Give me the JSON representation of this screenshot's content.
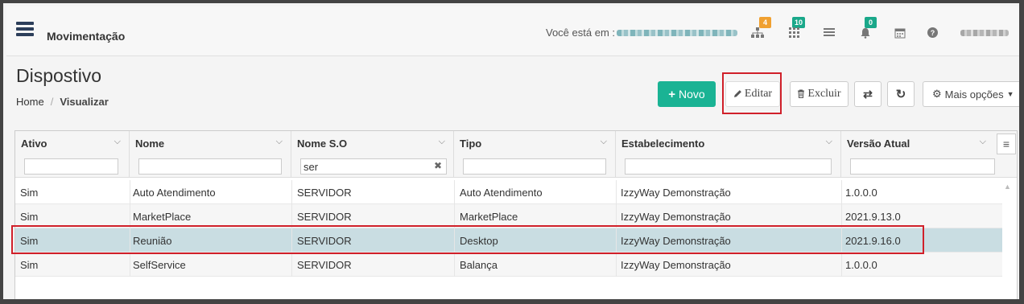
{
  "topbar": {
    "app_title": "Movimentação",
    "you_are_at": "Você está em :",
    "badge_tree": "4",
    "badge_grid": "10",
    "badge_bell": "0"
  },
  "page": {
    "title": "Dispostivo",
    "breadcrumb_home": "Home",
    "breadcrumb_sep": "/",
    "breadcrumb_current": "Visualizar"
  },
  "toolbar": {
    "novo": "Novo",
    "editar": "Editar",
    "excluir": "Excluir",
    "mais_opcoes": "Mais opções"
  },
  "grid": {
    "columns": [
      "Ativo",
      "Nome",
      "Nome S.O",
      "Tipo",
      "Estabelecimento",
      "Versão Atual"
    ],
    "filters": [
      "",
      "",
      "ser",
      "",
      "",
      ""
    ],
    "rows": [
      [
        "Sim",
        "Auto Atendimento",
        "SERVIDOR",
        "Auto Atendimento",
        "IzzyWay Demonstração",
        "1.0.0.0"
      ],
      [
        "Sim",
        "MarketPlace",
        "SERVIDOR",
        "MarketPlace",
        "IzzyWay Demonstração",
        "2021.9.13.0"
      ],
      [
        "Sim",
        "Reunião",
        "SERVIDOR",
        "Desktop",
        "IzzyWay Demonstração",
        "2021.9.16.0"
      ],
      [
        "Sim",
        "SelfService",
        "SERVIDOR",
        "Balança",
        "IzzyWay Demonstração",
        "1.0.0.0"
      ]
    ],
    "selected_row": 2
  },
  "colors": {
    "primary": "#1ab394",
    "highlight": "#d0202a",
    "selected_row": "#c9dde2"
  }
}
